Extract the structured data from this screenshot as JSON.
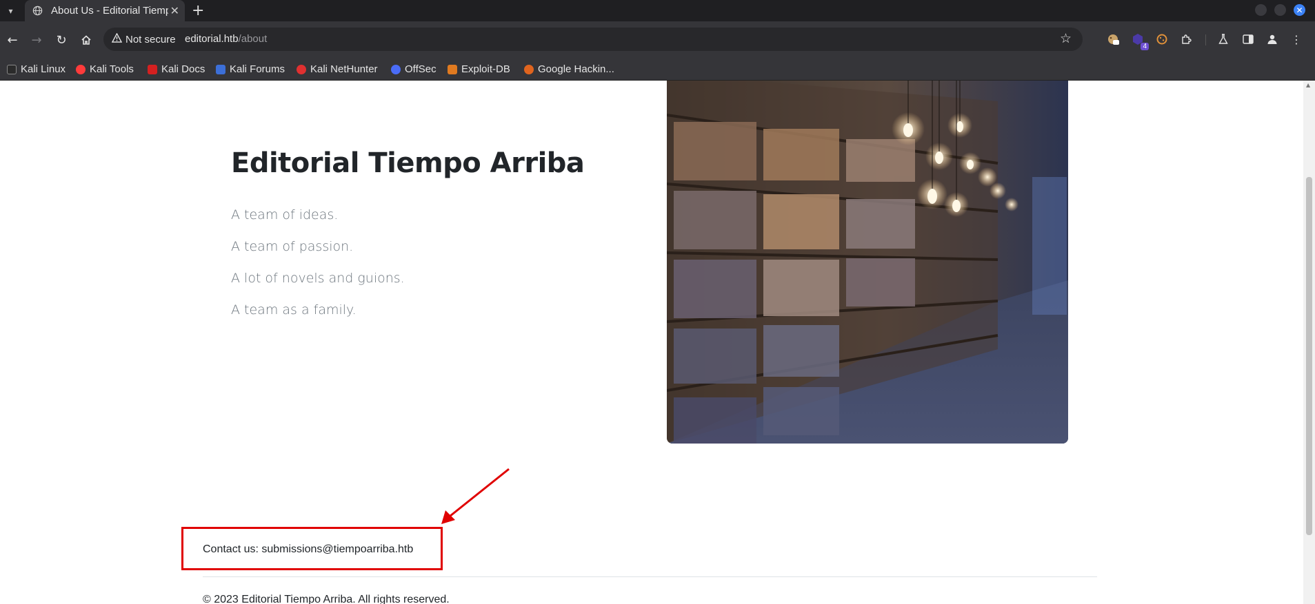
{
  "browser": {
    "tab_title": "About Us - Editorial Tiempo Arriba",
    "security_label": "Not secure",
    "url_host": "editorial.htb",
    "url_path": "/about",
    "extension_badge": "4"
  },
  "bookmarks": [
    {
      "label": "Kali Linux",
      "color": "#3c6fd8"
    },
    {
      "label": "Kali Tools",
      "color": "#ff3b3b"
    },
    {
      "label": "Kali Docs",
      "color": "#d42020"
    },
    {
      "label": "Kali Forums",
      "color": "#3c6fd8"
    },
    {
      "label": "Kali NetHunter",
      "color": "#e03030"
    },
    {
      "label": "OffSec",
      "color": "#4a6cf7"
    },
    {
      "label": "Exploit-DB",
      "color": "#e07a20"
    },
    {
      "label": "Google Hackin...",
      "color": "#e0641e"
    }
  ],
  "page": {
    "heading": "Editorial Tiempo Arriba",
    "lines": [
      "A team of ideas.",
      "A team of passion.",
      "A lot of novels and guions.",
      "A team as a family."
    ],
    "contact": "Contact us: submissions@tiempoarriba.htb",
    "copyright": "© 2023 Editorial Tiempo Arriba. All rights reserved."
  },
  "annotation": {
    "box_color": "#e00000",
    "arrow_color": "#e00000"
  }
}
